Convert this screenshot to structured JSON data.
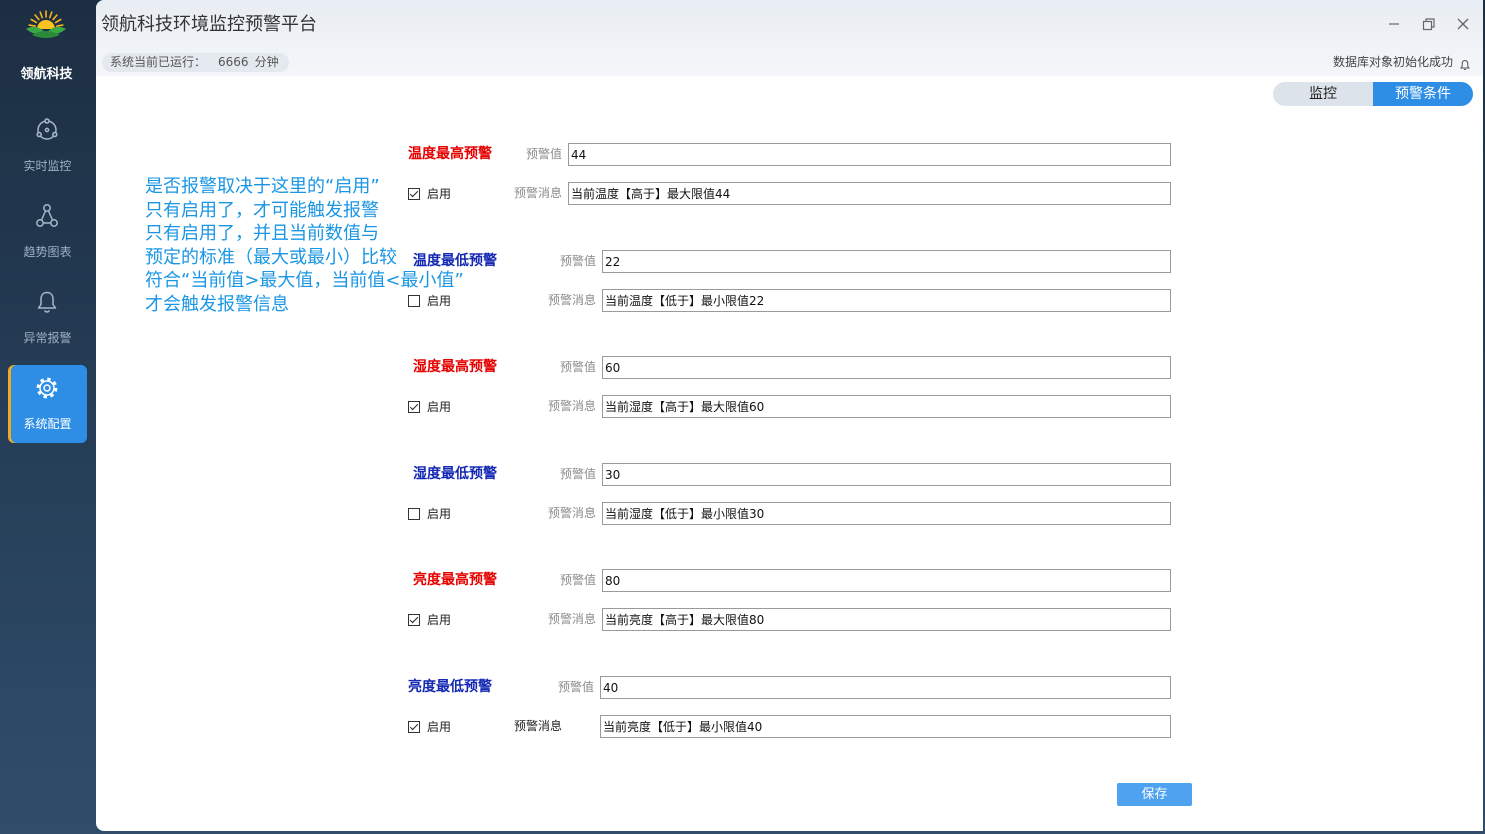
{
  "app": {
    "title": "领航科技环境监控预警平台",
    "brand": "领航科技",
    "logo_icon": "sun-leaves-logo-icon"
  },
  "window_controls": {
    "minimize": "minimize-icon",
    "restore": "restore-icon",
    "close": "close-icon"
  },
  "sidebar": {
    "items": [
      {
        "label": "实时监控",
        "icon": "monitor-nodes-icon",
        "active": false
      },
      {
        "label": "趋势图表",
        "icon": "trend-graph-icon",
        "active": false
      },
      {
        "label": "异常报警",
        "icon": "bell-icon",
        "active": false
      },
      {
        "label": "系统配置",
        "icon": "gear-icon",
        "active": true
      }
    ]
  },
  "status": {
    "runtime_label": "系统当前已运行：",
    "runtime_value": "6666",
    "runtime_unit": "分钟",
    "message": "数据库对象初始化成功",
    "message_icon": "bell-icon"
  },
  "tabs": [
    {
      "label": "监控",
      "active": false
    },
    {
      "label": "预警条件",
      "active": true
    }
  ],
  "annotation": {
    "lines": [
      "是否报警取决于这里的“启用”",
      "只有启用了，才可能触发报警",
      "只有启用了，并且当前数值与",
      "预定的标准（最大或最小）比较",
      "符合“当前值>最大值，当前值<最小值”",
      "才会触发报警信息"
    ]
  },
  "rules": [
    {
      "title": "温度最高预警",
      "color": "#e60000",
      "enabled": true,
      "enable_label": "启用",
      "value_label": "预警值",
      "value": "44",
      "message_label": "预警消息",
      "message": "当前温度【高于】最大限值44"
    },
    {
      "title": "温度最低预警",
      "color": "#1428b4",
      "enabled": false,
      "enable_label": "启用",
      "value_label": "预警值",
      "value": "22",
      "message_label": "预警消息",
      "message": "当前温度【低于】最小限值22"
    },
    {
      "title": "湿度最高预警",
      "color": "#e60000",
      "enabled": true,
      "enable_label": "启用",
      "value_label": "预警值",
      "value": "60",
      "message_label": "预警消息",
      "message": "当前湿度【高于】最大限值60"
    },
    {
      "title": "湿度最低预警",
      "color": "#1428b4",
      "enabled": false,
      "enable_label": "启用",
      "value_label": "预警值",
      "value": "30",
      "message_label": "预警消息",
      "message": "当前湿度【低于】最小限值30"
    },
    {
      "title": "亮度最高预警",
      "color": "#e60000",
      "enabled": true,
      "enable_label": "启用",
      "value_label": "预警值",
      "value": "80",
      "message_label": "预警消息",
      "message": "当前亮度【高于】最大限值80"
    },
    {
      "title": "亮度最低预警",
      "color": "#1428b4",
      "enabled": true,
      "enable_label": "启用",
      "value_label": "预警值",
      "value": "40",
      "message_label": "预警消息",
      "message": "当前亮度【低于】最小限值40"
    }
  ],
  "save_label": "保存",
  "colors": {
    "accent": "#2e8ee6",
    "annotation": "#1a96e4",
    "sidebar_top": "#1c2e42",
    "sidebar_bottom": "#2f4d6b",
    "active_marker": "#f5a623"
  }
}
